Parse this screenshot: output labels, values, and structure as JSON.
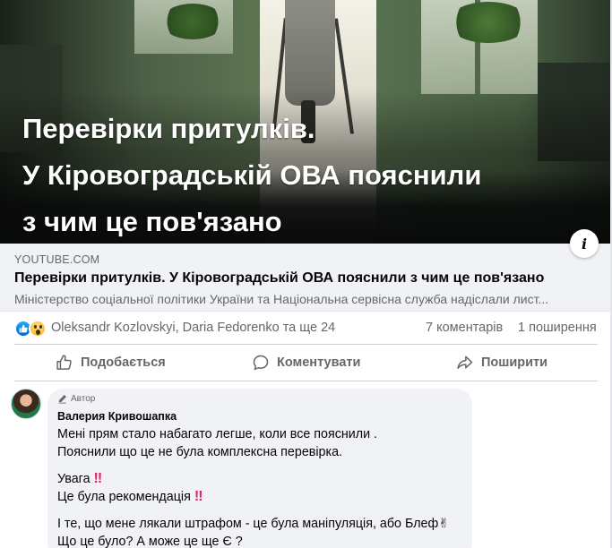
{
  "link_preview": {
    "headline_lines": [
      "Перевірки притулків.",
      "У Кіровоградській ОВА пояснили",
      "з чим це пов'язано"
    ],
    "domain": "YOUTUBE.COM",
    "title": "Перевірки притулків. У Кіровоградській ОВА пояснили з чим це пов'язано",
    "description": "Міністерство соціальної політики України та Національна сервісна служба надіслали лист...",
    "info_glyph": "i"
  },
  "reactions": {
    "icons": [
      "like-icon",
      "wow-icon"
    ],
    "names": "Oleksandr Kozlovskyi, Daria Fedorenko та ще 24",
    "comments": "7 коментарів",
    "shares": "1 поширення"
  },
  "actions": {
    "like": "Подобається",
    "comment": "Коментувати",
    "share": "Поширити"
  },
  "comment": {
    "badge": "Автор",
    "author": "Валерия Кривошапка",
    "lines": [
      "Мені прям стало набагато легше, коли все пояснили .",
      "Пояснили що це не була комплексна перевірка.",
      "Увага",
      "Це була рекомендація",
      "І те, що мене лякали штрафом - це була маніпуляція, або Блеф✌",
      "Що це було? А може це ще Є ?"
    ],
    "emphasis": "‼"
  },
  "colors": {
    "accent": "#1877f2",
    "secondary_text": "#65676b",
    "bubble": "#f0f2f5",
    "exclamation": "#e0245e"
  }
}
